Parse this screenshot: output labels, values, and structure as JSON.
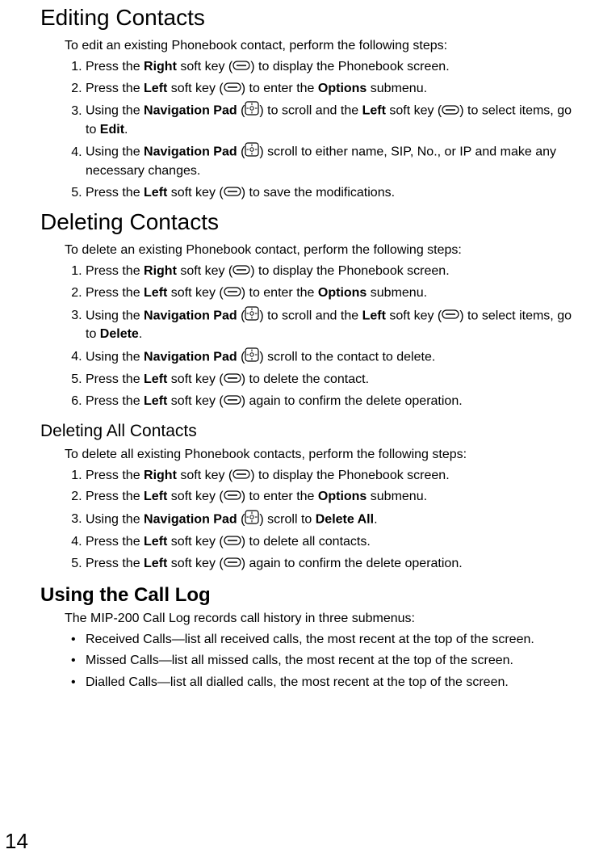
{
  "page_number": "14",
  "sections": {
    "editing": {
      "heading": "Editing Contacts",
      "intro": "To edit an existing Phonebook contact, perform the following steps:",
      "steps": {
        "s1_a": "Press the ",
        "s1_b": "Right",
        "s1_c": " soft key (",
        "s1_d": ") to display the Phonebook screen.",
        "s2_a": "Press the ",
        "s2_b": "Left",
        "s2_c": " soft key (",
        "s2_d": ") to enter the ",
        "s2_e": "Options",
        "s2_f": " submenu.",
        "s3_a": "Using the ",
        "s3_b": "Navigation Pad",
        "s3_c": " (",
        "s3_d": ") to scroll and the ",
        "s3_e": "Left",
        "s3_f": " soft key (",
        "s3_g": ") to select items, go to ",
        "s3_h": "Edit",
        "s3_i": ".",
        "s4_a": "Using the ",
        "s4_b": "Navigation Pad",
        "s4_c": " (",
        "s4_d": ") scroll to either name, SIP, No., or IP and make any necessary changes.",
        "s5_a": "Press the ",
        "s5_b": "Left",
        "s5_c": " soft key (",
        "s5_d": ") to save the modifications."
      }
    },
    "deleting": {
      "heading": "Deleting Contacts",
      "intro": "To delete an existing Phonebook contact, perform the following steps:",
      "steps": {
        "s1_a": "Press the ",
        "s1_b": "Right",
        "s1_c": " soft key (",
        "s1_d": ") to display the Phonebook screen.",
        "s2_a": "Press the ",
        "s2_b": "Left",
        "s2_c": " soft key (",
        "s2_d": ") to enter the ",
        "s2_e": "Options",
        "s2_f": " submenu.",
        "s3_a": "Using the ",
        "s3_b": "Navigation Pad",
        "s3_c": " (",
        "s3_d": ") to scroll and the ",
        "s3_e": "Left",
        "s3_f": " soft key (",
        "s3_g": ") to select items, go to ",
        "s3_h": "Delete",
        "s3_i": ".",
        "s4_a": "Using the ",
        "s4_b": "Navigation Pad",
        "s4_c": " (",
        "s4_d": ") scroll to the contact to delete.",
        "s5_a": "Press the ",
        "s5_b": "Left",
        "s5_c": " soft key (",
        "s5_d": ") to delete the contact.",
        "s6_a": "Press the ",
        "s6_b": "Left",
        "s6_c": " soft key (",
        "s6_d": ") again to confirm the delete operation."
      }
    },
    "deleting_all": {
      "heading": "Deleting All Contacts",
      "intro": "To delete all existing Phonebook contacts, perform the following steps:",
      "steps": {
        "s1_a": "Press the ",
        "s1_b": "Right",
        "s1_c": " soft key (",
        "s1_d": ") to display the Phonebook screen.",
        "s2_a": "Press the ",
        "s2_b": "Left",
        "s2_c": " soft key (",
        "s2_d": ") to enter the ",
        "s2_e": "Options",
        "s2_f": " submenu.",
        "s3_a": "Using the ",
        "s3_b": "Navigation Pad",
        "s3_c": " (",
        "s3_d": ") scroll to ",
        "s3_e": "Delete All",
        "s3_f": ".",
        "s4_a": "Press the ",
        "s4_b": "Left",
        "s4_c": " soft key (",
        "s4_d": ") to delete all contacts.",
        "s5_a": "Press the ",
        "s5_b": "Left",
        "s5_c": " soft key (",
        "s5_d": ") again to confirm the delete operation."
      }
    },
    "call_log": {
      "heading": "Using the Call Log",
      "intro": "The MIP-200 Call Log records call history in three submenus:",
      "bullets": {
        "b1": "Received Calls—list all received calls, the most recent at the top of the screen.",
        "b2": "Missed Calls—list all missed calls, the most recent at the top of the screen.",
        "b3": "Dialled Calls—list all dialled calls, the most recent at the top of the screen."
      }
    }
  },
  "icons": {
    "softkey": "soft-key-icon",
    "navpad": "navigation-pad-icon"
  }
}
